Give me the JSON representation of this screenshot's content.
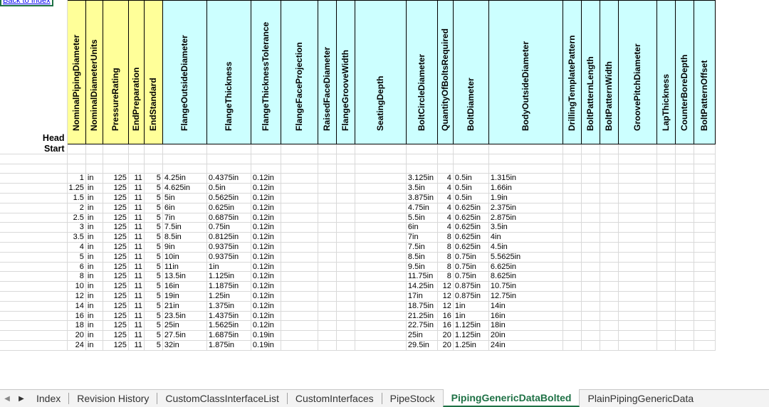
{
  "back_link": "Back to Index",
  "row_labels": {
    "head": "Head",
    "start": "Start"
  },
  "colors": {
    "key_header": "#ffff99",
    "data_header": "#ccffff",
    "active_tab": "#1e7145"
  },
  "columns": [
    {
      "name": "NominalPipingDiameter",
      "key": true
    },
    {
      "name": "NominalDiameterUnits",
      "key": true
    },
    {
      "name": "PressureRating",
      "key": true
    },
    {
      "name": "EndPreparation",
      "key": true
    },
    {
      "name": "EndStandard",
      "key": true
    },
    {
      "name": "FlangeOutsideDiameter",
      "key": false
    },
    {
      "name": "FlangeThickness",
      "key": false
    },
    {
      "name": "FlangeThicknessTolerance",
      "key": false
    },
    {
      "name": "FlangeFaceProjection",
      "key": false
    },
    {
      "name": "RaisedFaceDiameter",
      "key": false
    },
    {
      "name": "FlangeGrooveWidth",
      "key": false
    },
    {
      "name": "SeatingDepth",
      "key": false
    },
    {
      "name": "BoltCircleDiameter",
      "key": false
    },
    {
      "name": "QuantityOfBoltsRequired",
      "key": false
    },
    {
      "name": "BoltDiameter",
      "key": false
    },
    {
      "name": "BodyOutsideDiameter",
      "key": false
    },
    {
      "name": "DrillingTemplatePattern",
      "key": false
    },
    {
      "name": "BoltPatternLength",
      "key": false
    },
    {
      "name": "BoltPatternWidth",
      "key": false
    },
    {
      "name": "GroovePitchDiameter",
      "key": false
    },
    {
      "name": "LapThickness",
      "key": false
    },
    {
      "name": "CounterBoreDepth",
      "key": false
    },
    {
      "name": "BoltPatternOffset",
      "key": false
    }
  ],
  "rows": [
    [
      "1",
      "in",
      "125",
      "11",
      "5",
      "4.25in",
      "0.4375in",
      "0.12in",
      "",
      "",
      "",
      "",
      "3.125in",
      "4",
      "0.5in",
      "1.315in",
      "",
      "",
      "",
      "",
      "",
      "",
      ""
    ],
    [
      "1.25",
      "in",
      "125",
      "11",
      "5",
      "4.625in",
      "0.5in",
      "0.12in",
      "",
      "",
      "",
      "",
      "3.5in",
      "4",
      "0.5in",
      "1.66in",
      "",
      "",
      "",
      "",
      "",
      "",
      ""
    ],
    [
      "1.5",
      "in",
      "125",
      "11",
      "5",
      "5in",
      "0.5625in",
      "0.12in",
      "",
      "",
      "",
      "",
      "3.875in",
      "4",
      "0.5in",
      "1.9in",
      "",
      "",
      "",
      "",
      "",
      "",
      ""
    ],
    [
      "2",
      "in",
      "125",
      "11",
      "5",
      "6in",
      "0.625in",
      "0.12in",
      "",
      "",
      "",
      "",
      "4.75in",
      "4",
      "0.625in",
      "2.375in",
      "",
      "",
      "",
      "",
      "",
      "",
      ""
    ],
    [
      "2.5",
      "in",
      "125",
      "11",
      "5",
      "7in",
      "0.6875in",
      "0.12in",
      "",
      "",
      "",
      "",
      "5.5in",
      "4",
      "0.625in",
      "2.875in",
      "",
      "",
      "",
      "",
      "",
      "",
      ""
    ],
    [
      "3",
      "in",
      "125",
      "11",
      "5",
      "7.5in",
      "0.75in",
      "0.12in",
      "",
      "",
      "",
      "",
      "6in",
      "4",
      "0.625in",
      "3.5in",
      "",
      "",
      "",
      "",
      "",
      "",
      ""
    ],
    [
      "3.5",
      "in",
      "125",
      "11",
      "5",
      "8.5in",
      "0.8125in",
      "0.12in",
      "",
      "",
      "",
      "",
      "7in",
      "8",
      "0.625in",
      "4in",
      "",
      "",
      "",
      "",
      "",
      "",
      ""
    ],
    [
      "4",
      "in",
      "125",
      "11",
      "5",
      "9in",
      "0.9375in",
      "0.12in",
      "",
      "",
      "",
      "",
      "7.5in",
      "8",
      "0.625in",
      "4.5in",
      "",
      "",
      "",
      "",
      "",
      "",
      ""
    ],
    [
      "5",
      "in",
      "125",
      "11",
      "5",
      "10in",
      "0.9375in",
      "0.12in",
      "",
      "",
      "",
      "",
      "8.5in",
      "8",
      "0.75in",
      "5.5625in",
      "",
      "",
      "",
      "",
      "",
      "",
      ""
    ],
    [
      "6",
      "in",
      "125",
      "11",
      "5",
      "11in",
      "1in",
      "0.12in",
      "",
      "",
      "",
      "",
      "9.5in",
      "8",
      "0.75in",
      "6.625in",
      "",
      "",
      "",
      "",
      "",
      "",
      ""
    ],
    [
      "8",
      "in",
      "125",
      "11",
      "5",
      "13.5in",
      "1.125in",
      "0.12in",
      "",
      "",
      "",
      "",
      "11.75in",
      "8",
      "0.75in",
      "8.625in",
      "",
      "",
      "",
      "",
      "",
      "",
      ""
    ],
    [
      "10",
      "in",
      "125",
      "11",
      "5",
      "16in",
      "1.1875in",
      "0.12in",
      "",
      "",
      "",
      "",
      "14.25in",
      "12",
      "0.875in",
      "10.75in",
      "",
      "",
      "",
      "",
      "",
      "",
      ""
    ],
    [
      "12",
      "in",
      "125",
      "11",
      "5",
      "19in",
      "1.25in",
      "0.12in",
      "",
      "",
      "",
      "",
      "17in",
      "12",
      "0.875in",
      "12.75in",
      "",
      "",
      "",
      "",
      "",
      "",
      ""
    ],
    [
      "14",
      "in",
      "125",
      "11",
      "5",
      "21in",
      "1.375in",
      "0.12in",
      "",
      "",
      "",
      "",
      "18.75in",
      "12",
      "1in",
      "14in",
      "",
      "",
      "",
      "",
      "",
      "",
      ""
    ],
    [
      "16",
      "in",
      "125",
      "11",
      "5",
      "23.5in",
      "1.4375in",
      "0.12in",
      "",
      "",
      "",
      "",
      "21.25in",
      "16",
      "1in",
      "16in",
      "",
      "",
      "",
      "",
      "",
      "",
      ""
    ],
    [
      "18",
      "in",
      "125",
      "11",
      "5",
      "25in",
      "1.5625in",
      "0.12in",
      "",
      "",
      "",
      "",
      "22.75in",
      "16",
      "1.125in",
      "18in",
      "",
      "",
      "",
      "",
      "",
      "",
      ""
    ],
    [
      "20",
      "in",
      "125",
      "11",
      "5",
      "27.5in",
      "1.6875in",
      "0.19in",
      "",
      "",
      "",
      "",
      "25in",
      "20",
      "1.125in",
      "20in",
      "",
      "",
      "",
      "",
      "",
      "",
      ""
    ],
    [
      "24",
      "in",
      "125",
      "11",
      "5",
      "32in",
      "1.875in",
      "0.19in",
      "",
      "",
      "",
      "",
      "29.5in",
      "20",
      "1.25in",
      "24in",
      "",
      "",
      "",
      "",
      "",
      "",
      ""
    ]
  ],
  "sheet_tabs": [
    {
      "label": "Index",
      "active": false
    },
    {
      "label": "Revision History",
      "active": false
    },
    {
      "label": "CustomClassInterfaceList",
      "active": false
    },
    {
      "label": "CustomInterfaces",
      "active": false
    },
    {
      "label": "PipeStock",
      "active": false
    },
    {
      "label": "PipingGenericDataBolted",
      "active": true
    },
    {
      "label": "PlainPipingGenericData",
      "active": false
    }
  ]
}
